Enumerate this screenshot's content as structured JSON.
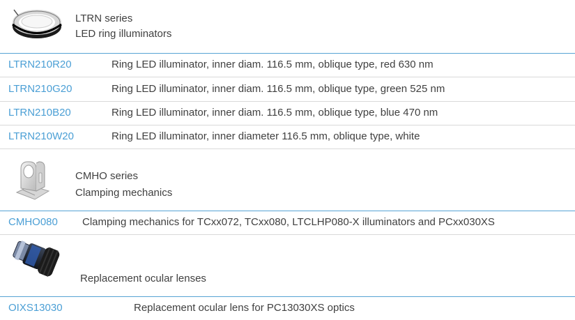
{
  "sections": [
    {
      "series_title": "LTRN series",
      "series_subtitle": "LED ring illuminators",
      "image_icon": "ring-illuminator-image",
      "rows": [
        {
          "code": "LTRN210R20",
          "description": "Ring LED illuminator, inner diam. 116.5 mm, oblique type, red 630 nm"
        },
        {
          "code": "LTRN210G20",
          "description": "Ring LED illuminator, inner diam. 116.5 mm, oblique type, green 525 nm"
        },
        {
          "code": "LTRN210B20",
          "description": "Ring LED illuminator, inner diam. 116.5 mm, oblique type, blue 470 nm"
        },
        {
          "code": "LTRN210W20",
          "description": "Ring LED illuminator, inner diameter 116.5 mm, oblique type, white"
        }
      ]
    },
    {
      "series_title": "CMHO series",
      "series_subtitle": "Clamping mechanics",
      "image_icon": "clamping-bracket-image",
      "rows": [
        {
          "code": "CMHO080",
          "description": "Clamping mechanics for TCxx072, TCxx080, LTCLHP080-X illuminators and PCxx030XS"
        }
      ]
    },
    {
      "series_title": "",
      "series_subtitle": "Replacement ocular lenses",
      "image_icon": "ocular-lens-image",
      "rows": [
        {
          "code": "OIXS13030",
          "description": "Replacement ocular lens for PC13030XS optics"
        }
      ]
    }
  ],
  "colors": {
    "link": "#4b9fd5",
    "text": "#404040",
    "rule_blue": "#56a3d4",
    "rule_gray": "#d9d9d9"
  }
}
